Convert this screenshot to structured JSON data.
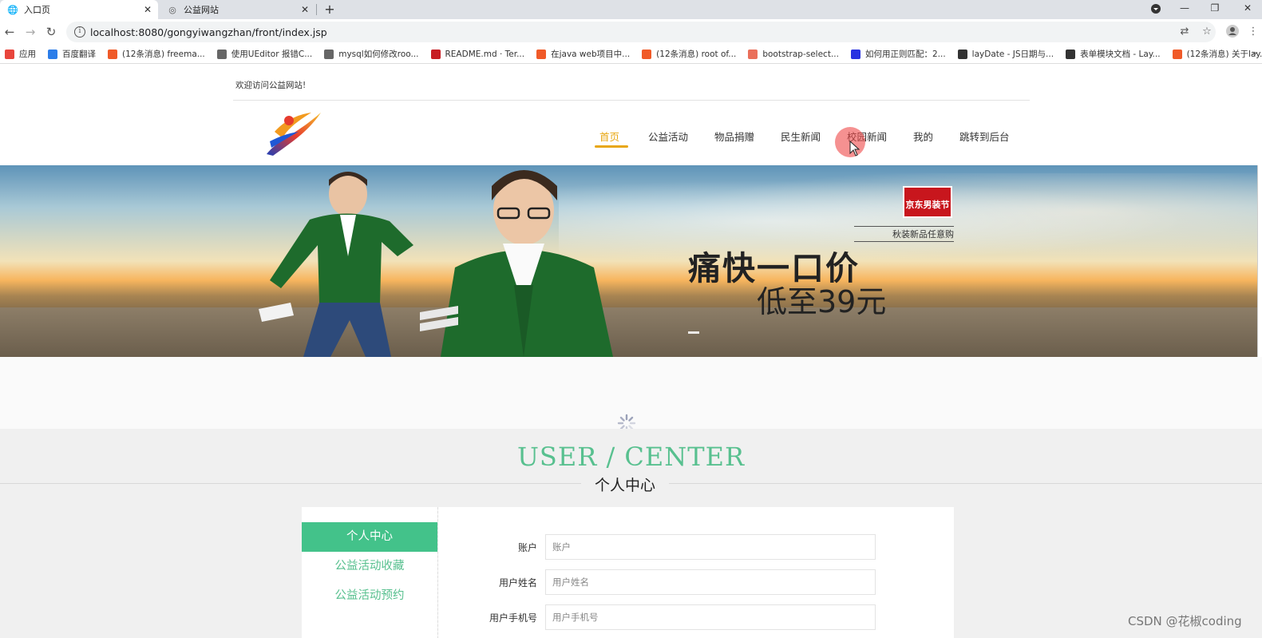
{
  "browser": {
    "tabs": [
      {
        "label": "入口页",
        "active": true
      },
      {
        "label": "公益网站",
        "active": false
      }
    ],
    "url": "localhost:8080/gongyiwangzhan/front/index.jsp",
    "bookmarks": [
      {
        "label": "应用",
        "icon": "apps-grid-icon",
        "color": "#e8453c"
      },
      {
        "label": "百度翻译",
        "icon": "baidu-translate-icon",
        "color": "#2b7de9"
      },
      {
        "label": "(12条消息) freema...",
        "icon": "csdn-icon",
        "color": "#f05a28"
      },
      {
        "label": "使用UEditor 报错C...",
        "icon": "generic-site-icon",
        "color": "#666666"
      },
      {
        "label": "mysql如何修改roo...",
        "icon": "generic-site-icon",
        "color": "#666666"
      },
      {
        "label": "README.md · Ter...",
        "icon": "gitee-icon",
        "color": "#c71d23"
      },
      {
        "label": "在java web项目中...",
        "icon": "csdn-icon",
        "color": "#f05a28"
      },
      {
        "label": "(12条消息) root of...",
        "icon": "csdn-icon",
        "color": "#f05a28"
      },
      {
        "label": "bootstrap-select...",
        "icon": "jianshu-icon",
        "color": "#ea6f5a"
      },
      {
        "label": "如何用正则匹配：2...",
        "icon": "baidu-icon",
        "color": "#2932e1"
      },
      {
        "label": "layDate - JS日期与...",
        "icon": "layui-icon",
        "color": "#333333"
      },
      {
        "label": "表单模块文档 - Lay...",
        "icon": "layui-icon",
        "color": "#333333"
      },
      {
        "label": "(12条消息) 关于lay...",
        "icon": "csdn-icon",
        "color": "#f05a28"
      }
    ],
    "bookmarks_more": "»"
  },
  "site": {
    "welcome": "欢迎访问公益网站!",
    "nav": [
      {
        "label": "首页",
        "active": true
      },
      {
        "label": "公益活动",
        "active": false
      },
      {
        "label": "物品捐赠",
        "active": false
      },
      {
        "label": "民生新闻",
        "active": false
      },
      {
        "label": "校园新闻",
        "active": false
      },
      {
        "label": "我的",
        "active": false
      },
      {
        "label": "跳转到后台",
        "active": false
      }
    ],
    "banner": {
      "badge": "京东男装节",
      "subtitle": "秋装新品任意购",
      "headline": "痛快一口价",
      "price": "低至39元"
    },
    "user_center": {
      "title": "USER / CENTER",
      "subtitle": "个人中心",
      "menu": [
        {
          "label": "个人中心",
          "active": true
        },
        {
          "label": "公益活动收藏",
          "active": false
        },
        {
          "label": "公益活动预约",
          "active": false
        }
      ],
      "form": [
        {
          "label": "账户",
          "placeholder": "账户"
        },
        {
          "label": "用户姓名",
          "placeholder": "用户姓名"
        },
        {
          "label": "用户手机号",
          "placeholder": "用户手机号"
        }
      ]
    }
  },
  "watermark": "CSDN @花椒coding",
  "colors": {
    "accent_gold": "#e8a712",
    "accent_green": "#43c28a",
    "title_green": "#58c08f"
  }
}
